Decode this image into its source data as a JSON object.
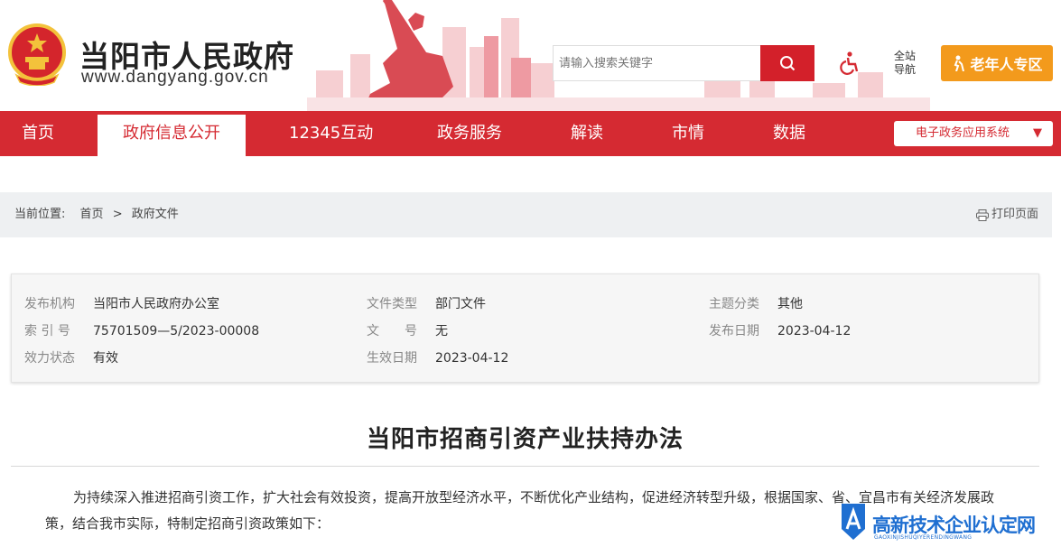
{
  "header": {
    "site_title": "当阳市人民政府",
    "site_url": "www.dangyang.gov.cn",
    "search_placeholder": "请输入搜索关键字",
    "site_nav_line1": "全站",
    "site_nav_line2": "导航",
    "elder_label": "老年人专区"
  },
  "nav": {
    "items": [
      {
        "label": "首页"
      },
      {
        "label": "政府信息公开"
      },
      {
        "label": "12345互动"
      },
      {
        "label": "政务服务"
      },
      {
        "label": "解读"
      },
      {
        "label": "市情"
      },
      {
        "label": "数据"
      }
    ],
    "active_index": 1,
    "ebiz_label": "电子政务应用系统",
    "ebiz_caret": "▼"
  },
  "breadcrumb": {
    "prefix": "当前位置:",
    "items": [
      "首页",
      "政府文件"
    ],
    "separator": ">",
    "print_label": "打印页面"
  },
  "meta": {
    "publisher_label": "发布机构",
    "publisher": "当阳市人民政府办公室",
    "doctype_label": "文件类型",
    "doctype": "部门文件",
    "topic_label": "主题分类",
    "topic": "其他",
    "index_label": "索 引 号",
    "index": "75701509—5/2023-00008",
    "docno_label": "文　　号",
    "docno": "无",
    "pubdate_label": "发布日期",
    "pubdate": "2023-04-12",
    "status_label": "效力状态",
    "status": "有效",
    "effdate_label": "生效日期",
    "effdate": "2023-04-12"
  },
  "article": {
    "title": "当阳市招商引资产业扶持办法",
    "paragraph": "为持续深入推进招商引资工作，扩大社会有效投资，提高开放型经济水平，不断优化产业结构，促进经济转型升级，根据国家、省、宜昌市有关经济发展政策，结合我市实际，特制定招商引资政策如下："
  },
  "watermark": {
    "text": "高新技术企业认定网",
    "sub": "GAOXINJISHUQIYERENDINGWANG"
  },
  "colors": {
    "brand_red": "#d52a32",
    "elder_orange": "#f39a1c",
    "watermark_blue": "#1f6fd1"
  }
}
